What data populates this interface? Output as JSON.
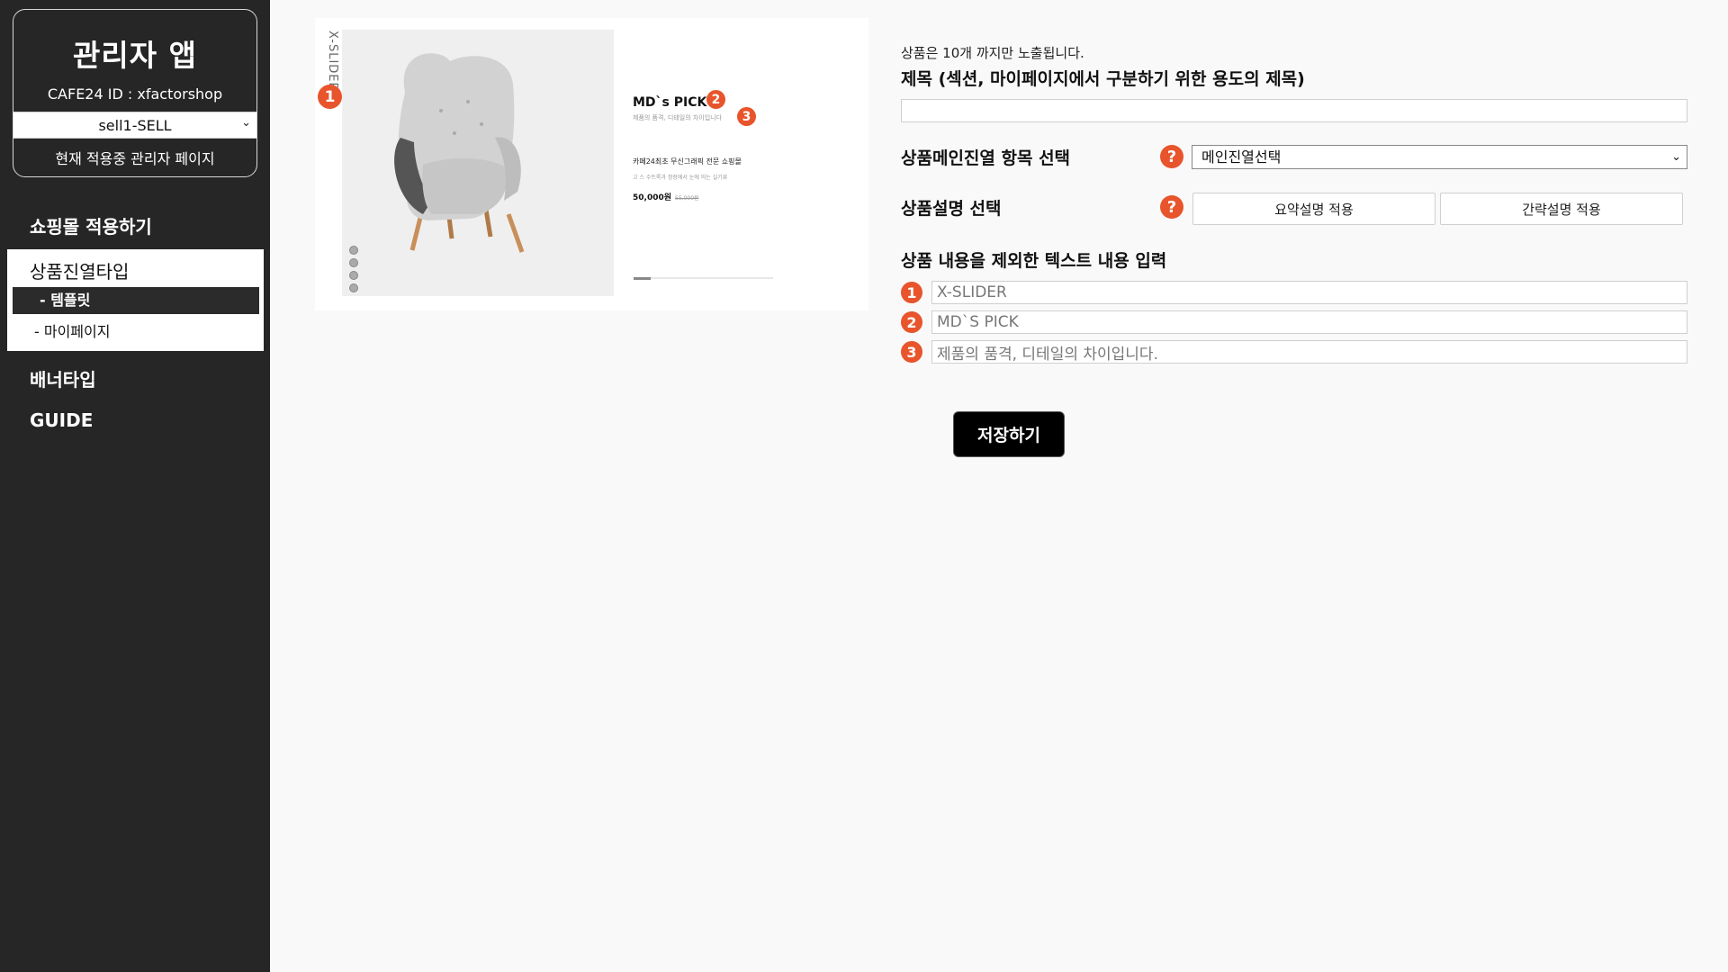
{
  "sidebar": {
    "app_title": "관리자 앱",
    "cafe_id": "CAFE24 ID : xfactorshop",
    "shop_select": "sell1-SELL",
    "current_admin": "현재 적용중 관리자 페이지",
    "nav": {
      "shop_apply": "쇼핑몰 적용하기",
      "product_display": "상품진열타입",
      "template": "- 템플릿",
      "mypage": "- 마이페이지",
      "banner": "배너타입",
      "guide": "GUIDE"
    }
  },
  "preview": {
    "vertical_label": "X-SLIDER",
    "badges": [
      "1",
      "2",
      "3"
    ],
    "md_pick": "MD`s PICK",
    "subtitle": "제품의 품격, 디테일의 차이입니다",
    "product_name": "카페24최초 무신그래픽 전문 쇼핑몰",
    "product_desc": "고 스 수트룩과 정장에서 눈에 띄는 실기류",
    "price": "50,000원",
    "old_price": "55,000원",
    "slider_dot_count": 4,
    "progress_fraction": 0.12
  },
  "form": {
    "notice": "상품은 10개 까지만 노출됩니다.",
    "title_label": "제목 (섹션, 마이페이지에서 구분하기 위한 용도의 제목)",
    "title_value": "",
    "display_label": "상품메인진열 항목 선택",
    "display_select": "메인진열선택",
    "desc_label": "상품설명 선택",
    "desc_summary_button": "요약설명 적용",
    "desc_brief_button": "간략설명 적용",
    "text_section_label": "상품 내용을 제외한 텍스트 내용 입력",
    "text_inputs": [
      {
        "badge": "1",
        "value": "X-SLIDER"
      },
      {
        "badge": "2",
        "value": "MD`S PICK"
      },
      {
        "badge": "3",
        "value": "제품의 품격, 디테일의 차이입니다."
      }
    ],
    "help_glyph": "?",
    "save_button": "저장하기"
  },
  "colors": {
    "sidebar_bg": "#262626",
    "accent": "#e8542b",
    "page_bg": "#f9f9f9"
  }
}
